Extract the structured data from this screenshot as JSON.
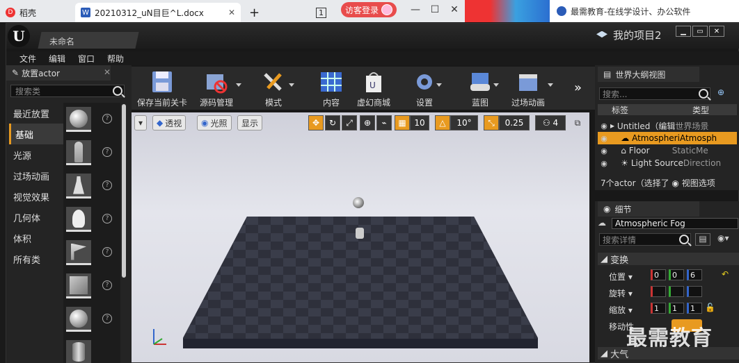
{
  "browser": {
    "tab1": "稻壳",
    "tab2": "20210312_uN目巨^L.docx",
    "tab2_icon": "W",
    "visit_btn": "访客登录",
    "tab_num": "1",
    "edu_tab": "最需教育-在线学设计、办公软件"
  },
  "ue": {
    "logo": "U",
    "tab": "未命名",
    "project": "我的项目2",
    "menu": [
      "文件",
      "编辑",
      "窗口",
      "帮助"
    ]
  },
  "place": {
    "title": "放置actor",
    "search": "搜索类",
    "categories": [
      "最近放置",
      "基础",
      "光源",
      "过场动画",
      "视觉效果",
      "几何体",
      "体积",
      "所有类"
    ],
    "q": "?"
  },
  "toolbar": {
    "save": "保存当前关卡",
    "source": "源码管理",
    "modes": "模式",
    "content": "内容",
    "market": "虚幻商城",
    "settings": "设置",
    "blueprints": "蓝图",
    "cinematics": "过场动画",
    "more": "»"
  },
  "viewport": {
    "perspective": "透视",
    "lit": "光照",
    "show": "显示",
    "grid": "10",
    "angle": "10°",
    "scale": "0.25",
    "cam": "4"
  },
  "outliner": {
    "title": "世界大纲视图",
    "search": "搜索...",
    "col_label": "标签",
    "col_type": "类型",
    "rows": [
      {
        "label": "Untitled（编辑",
        "type": "世界场景"
      },
      {
        "label": "AtmospheriAtmosph",
        "type": ""
      },
      {
        "label": "Floor",
        "type": "StaticMe"
      },
      {
        "label": "Light Source",
        "type": "Direction"
      }
    ],
    "footer": "7个actor（选择了",
    "view_opts": "视图选项"
  },
  "details": {
    "title": "细节",
    "name": "Atmospheric Fog",
    "search": "搜索详情",
    "transform": "变换",
    "location": "位置",
    "rotation": "旋转",
    "scale": "缩放",
    "mobility": "移动性",
    "atmo": "大气",
    "loc_vals": [
      "0",
      "0",
      "6"
    ],
    "scale_vals": [
      "1",
      "1",
      "1"
    ]
  },
  "watermark": "最需教育"
}
